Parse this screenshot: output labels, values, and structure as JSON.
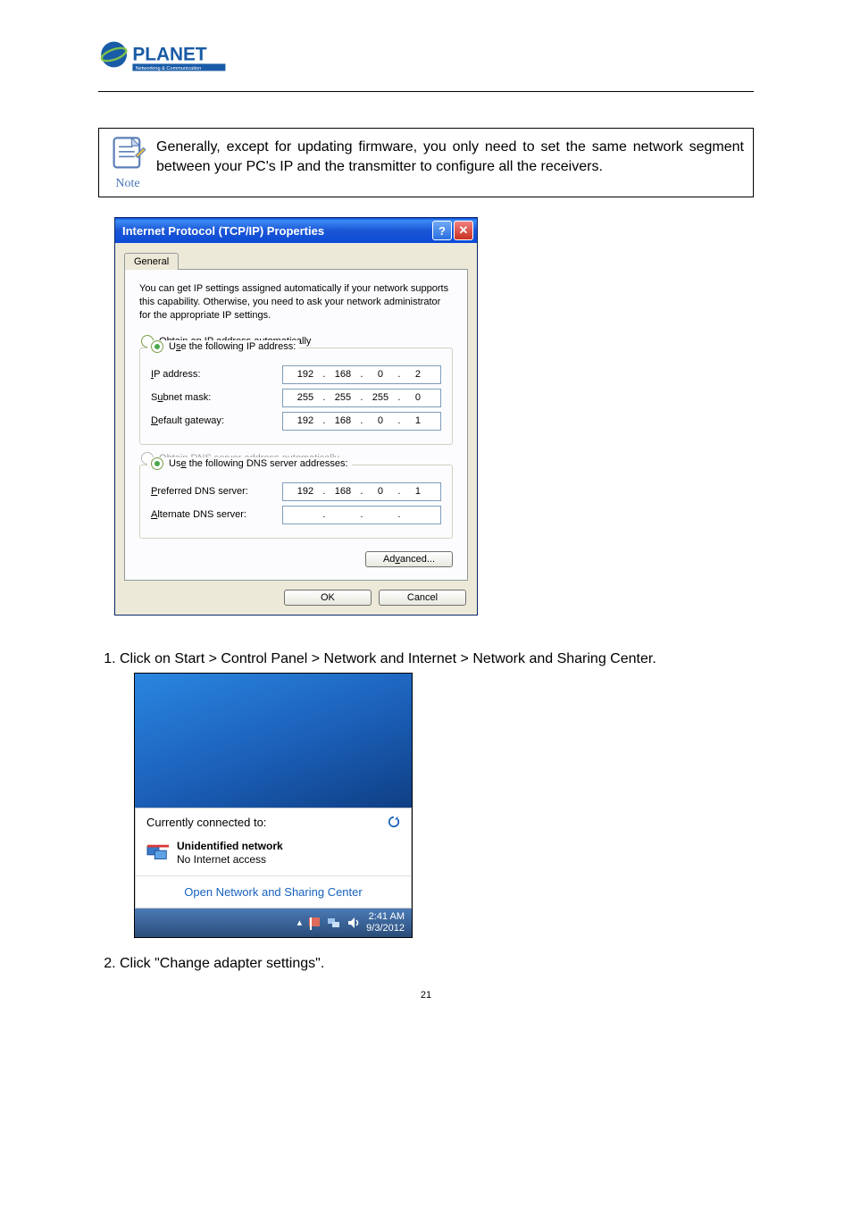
{
  "logo": {
    "brand": "PLANET",
    "tagline": "Networking & Communication"
  },
  "note": {
    "label": "Note",
    "text": "Generally, except for updating firmware, you only need to set the same network segment between your PC's IP and the transmitter to configure all the receivers."
  },
  "dialog": {
    "title": "Internet Protocol (TCP/IP) Properties",
    "help": "?",
    "close": "✕",
    "tab": "General",
    "intro": "You can get IP settings assigned automatically if your network supports this capability. Otherwise, you need to ask your network administrator for the appropriate IP settings.",
    "radio_obtain_ip": "Obtain an IP address automatically",
    "radio_use_ip": "Use the following IP address:",
    "fields": {
      "ip_label": "IP address:",
      "ip": [
        "192",
        "168",
        "0",
        "2"
      ],
      "subnet_label": "Subnet mask:",
      "subnet": [
        "255",
        "255",
        "255",
        "0"
      ],
      "gateway_label": "Default gateway:",
      "gateway": [
        "192",
        "168",
        "0",
        "1"
      ]
    },
    "radio_obtain_dns": "Obtain DNS server address automatically",
    "radio_use_dns": "Use the following DNS server addresses:",
    "dns": {
      "pref_label": "Preferred DNS server:",
      "pref": [
        "192",
        "168",
        "0",
        "1"
      ],
      "alt_label": "Alternate DNS server:",
      "alt": [
        "",
        "",
        "",
        ""
      ]
    },
    "advanced": "Advanced...",
    "ok": "OK",
    "cancel": "Cancel"
  },
  "steps": {
    "s1": "Click on Start > Control Panel > Network and Internet > Network and Sharing Center.",
    "s2": "Click \"Change adapter settings\"."
  },
  "tray": {
    "currently": "Currently connected to:",
    "unident": "Unidentified network",
    "noaccess": "No Internet access",
    "open_center": "Open Network and Sharing Center",
    "time": "2:41 AM",
    "date": "9/3/2012",
    "arrow": "▴"
  },
  "page_number": "21"
}
